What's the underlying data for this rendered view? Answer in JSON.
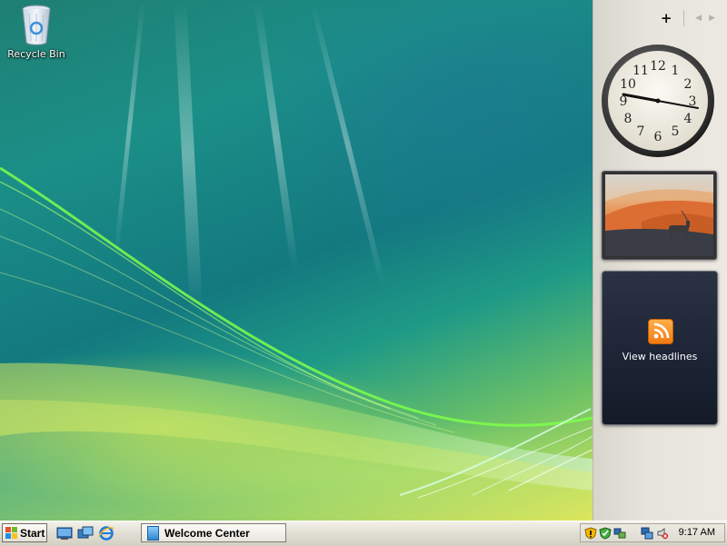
{
  "desktop": {
    "icons": [
      {
        "label": "Recycle Bin",
        "icon": "recycle-bin-icon"
      }
    ]
  },
  "sidebar": {
    "add_gadget_glyph": "+",
    "prev_glyph": "◀",
    "next_glyph": "▶",
    "clock": {
      "numerals": [
        "12",
        "1",
        "2",
        "3",
        "4",
        "5",
        "6",
        "7",
        "8",
        "9",
        "10",
        "11"
      ],
      "time_shown": "9:17"
    },
    "slideshow": {
      "icon": "slideshow-photo"
    },
    "feed": {
      "label": "View headlines",
      "icon": "rss-icon"
    }
  },
  "taskbar": {
    "start_label": "Start",
    "quick_launch": [
      "show-desktop-icon",
      "switch-windows-icon",
      "internet-explorer-icon"
    ],
    "tasks": [
      {
        "label": "Welcome Center",
        "icon": "welcome-center-icon"
      }
    ],
    "tray_icons": [
      "warning-shield-icon",
      "security-shield-icon",
      "network-sharing-icon",
      "network-icon",
      "volume-muted-icon"
    ],
    "time": "9:17 AM"
  },
  "colors": {
    "taskbar_bg": "#e0ddd3",
    "sidebar_bg": "#e7e4dc",
    "feed_bg": "#1d2536",
    "rss_orange": "#f07a10"
  }
}
